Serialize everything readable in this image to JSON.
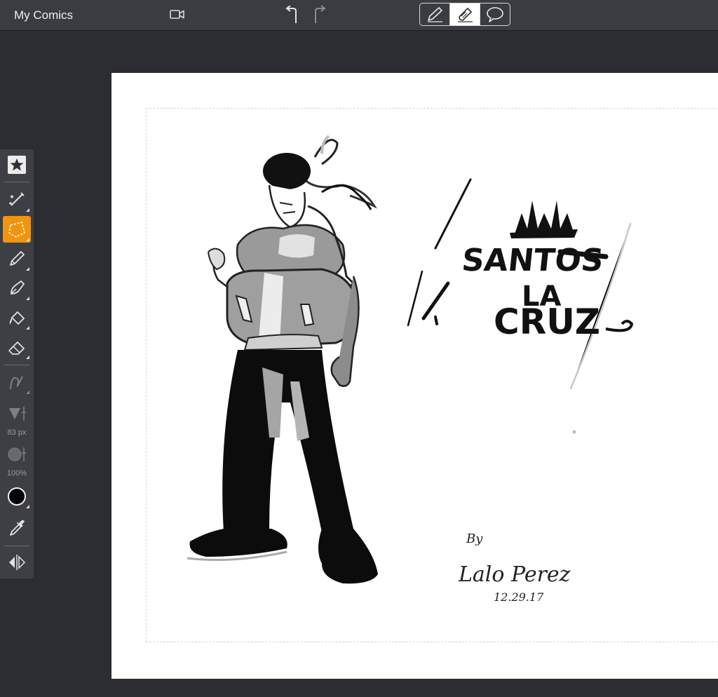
{
  "app": {
    "title": "My Comics"
  },
  "header": {
    "record_icon": "video-camera-icon",
    "undo_icon": "undo-icon",
    "redo_icon": "redo-icon",
    "modes": [
      {
        "name": "pencil-mode",
        "icon": "pencil-icon",
        "active": false
      },
      {
        "name": "marker-mode",
        "icon": "marker-icon",
        "active": true
      },
      {
        "name": "speech-bubble-mode",
        "icon": "speech-bubble-icon",
        "active": false
      }
    ]
  },
  "toolbar": {
    "tools": [
      "favorites-star-icon",
      "magic-wand-icon",
      "lasso-selection-icon",
      "pencil-icon",
      "pen-icon",
      "fill-bucket-icon",
      "eraser-icon",
      "smoothing-curve-icon",
      "brush-size-icon",
      "opacity-icon",
      "color-swatch-icon",
      "eyedropper-icon",
      "symmetry-icon"
    ],
    "selected_tool": "lasso-selection-icon",
    "brush_size": "83 px",
    "opacity": "100%",
    "current_color": "#000000",
    "accent_color": "#f0950e"
  },
  "artwork": {
    "logo_text": "SANTOS LA CRUZ",
    "signature_by": "By",
    "signature_name": "Lalo Perez",
    "signature_date": "12.29.17"
  }
}
